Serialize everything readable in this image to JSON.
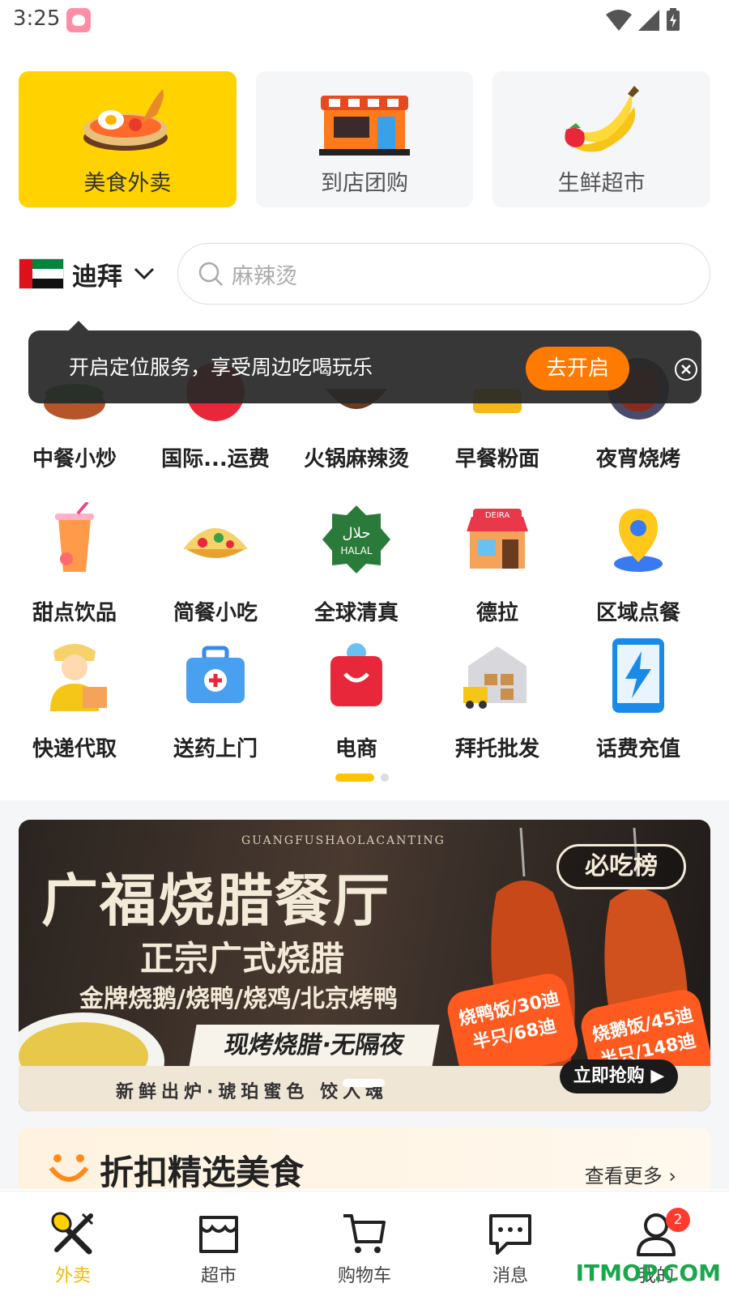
{
  "status_bar": {
    "time": "3:25"
  },
  "top_cards": [
    {
      "label": "美食外卖",
      "icon": "noodle-bowl-icon",
      "active": true
    },
    {
      "label": "到店团购",
      "icon": "storefront-icon",
      "active": false
    },
    {
      "label": "生鲜超市",
      "icon": "banana-fruit-icon",
      "active": false
    }
  ],
  "location": {
    "city": "迪拜",
    "flag": "uae-flag-icon"
  },
  "search": {
    "placeholder": "麻辣烫"
  },
  "tooltip": {
    "text": "开启定位服务，享受周边吃喝玩乐",
    "button": "去开启"
  },
  "categories": [
    [
      {
        "label": "中餐小炒",
        "icon": "stir-fry-icon"
      },
      {
        "label": "国际...运费",
        "icon": "coupon-icon"
      },
      {
        "label": "火锅麻辣烫",
        "icon": "hotpot-icon"
      },
      {
        "label": "早餐粉面",
        "icon": "breakfast-icon"
      },
      {
        "label": "夜宵烧烤",
        "icon": "bbq-icon"
      }
    ],
    [
      {
        "label": "甜点饮品",
        "icon": "drink-cup-icon"
      },
      {
        "label": "简餐小吃",
        "icon": "taco-icon"
      },
      {
        "label": "全球清真",
        "icon": "halal-badge-icon"
      },
      {
        "label": "德拉",
        "icon": "deira-shop-icon"
      },
      {
        "label": "区域点餐",
        "icon": "location-pin-icon"
      }
    ],
    [
      {
        "label": "快递代取",
        "icon": "courier-icon"
      },
      {
        "label": "送药上门",
        "icon": "medical-kit-icon"
      },
      {
        "label": "电商",
        "icon": "shopping-bag-icon"
      },
      {
        "label": "拜托批发",
        "icon": "warehouse-truck-icon"
      },
      {
        "label": "话费充值",
        "icon": "phone-recharge-icon"
      }
    ]
  ],
  "banner": {
    "sub_en": "GUANGFUSHAOLACANTING",
    "title": "广福烧腊餐厅",
    "badge": "必吃榜",
    "subtitle": "正宗广式烧腊",
    "menu": "金牌烧鹅/烧鸭/烧鸡/北京烤鸭",
    "slogan": "现烤烧腊·无隔夜",
    "price1": [
      "烧鸭饭/30迪",
      "半只/68迪"
    ],
    "price2": [
      "烧鹅饭/45迪",
      "半只/148迪"
    ],
    "footer": "新鲜出炉·琥珀蜜色 饺入魂",
    "buy": "立即抢购"
  },
  "discount": {
    "title": "折扣精选美食",
    "more": "查看更多"
  },
  "bottom_nav": [
    {
      "label": "外卖",
      "icon": "fork-spoon-icon",
      "active": true
    },
    {
      "label": "超市",
      "icon": "store-icon",
      "active": false
    },
    {
      "label": "购物车",
      "icon": "cart-icon",
      "active": false
    },
    {
      "label": "消息",
      "icon": "message-icon",
      "active": false
    },
    {
      "label": "我的",
      "icon": "user-icon",
      "active": false,
      "badge": "2"
    }
  ],
  "watermark": "ITMOP.COM",
  "colors": {
    "accent": "#ffd200",
    "orange": "#ff7a00",
    "active_nav": "#f5b800",
    "badge": "#ff3b30"
  }
}
